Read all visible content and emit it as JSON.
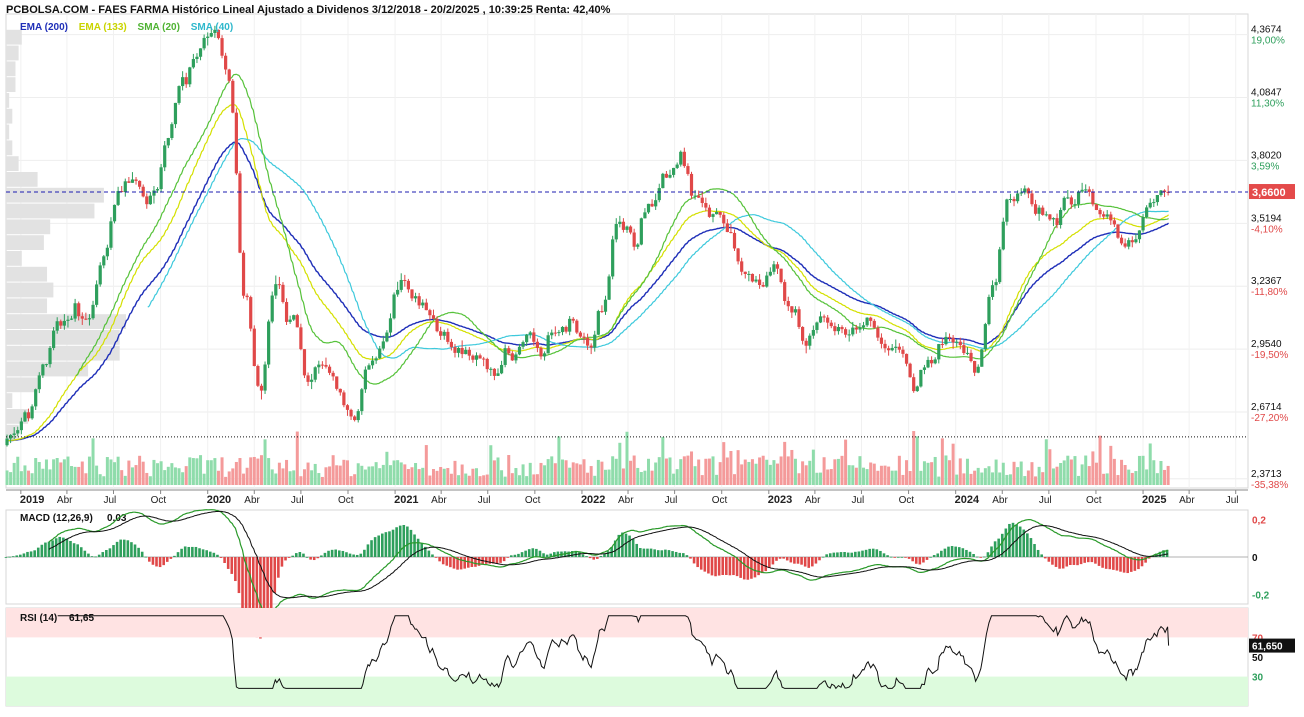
{
  "header": {
    "title": "PCBOLSA.COM - FAES FARMA Histórico Lineal Ajustado a Dividenos 3/12/2018 - 20/2/2025 , 10:39:25 Renta: 42,40%"
  },
  "legend": [
    {
      "label": "EMA (200)",
      "color": "#1f2fb8"
    },
    {
      "label": "EMA (133)",
      "color": "#d4e000"
    },
    {
      "label": "SMA (20)",
      "color": "#56c23a"
    },
    {
      "label": "SMA (40)",
      "color": "#3ec9dc"
    }
  ],
  "colors": {
    "up": "#2e9f5c",
    "down": "#e04848",
    "vol_up": "#8fdcab",
    "vol_down": "#f49a9a",
    "price_line": "#1c1cb0",
    "price_tag": "#e44a4a"
  },
  "chart_data": [
    {
      "type": "candlestick",
      "title": "FAES FARMA",
      "x_axis_labels": [
        "2019",
        "Abr",
        "Jul",
        "Oct",
        "2020",
        "Abr",
        "Jul",
        "Oct",
        "2021",
        "Abr",
        "Jul",
        "Oct",
        "2022",
        "Abr",
        "Jul",
        "Oct",
        "2023",
        "Abr",
        "Jul",
        "Oct",
        "2024",
        "Abr",
        "Jul",
        "Oct",
        "2025",
        "Abr",
        "Jul"
      ],
      "y_ticks": [
        {
          "value": 4.3674,
          "label": "4,3674",
          "pct": "19,00%"
        },
        {
          "value": 4.0847,
          "label": "4,0847",
          "pct": "11,30%"
        },
        {
          "value": 3.802,
          "label": "3,8020",
          "pct": "3,59%"
        },
        {
          "value": 3.5194,
          "label": "3,5194",
          "pct": "-4,10%"
        },
        {
          "value": 3.2367,
          "label": "3,2367",
          "pct": "-11,80%"
        },
        {
          "value": 2.954,
          "label": "2,9540",
          "pct": "-19,50%"
        },
        {
          "value": 2.6714,
          "label": "2,6714",
          "pct": "-27,20%"
        },
        {
          "value": 2.3713,
          "label": "2,3713",
          "pct": "-35,38%"
        }
      ],
      "ylim": [
        2.33,
        4.46
      ],
      "last_price": {
        "value": 3.66,
        "label": "3,6600"
      },
      "reference_lines": [
        {
          "value": 3.66,
          "style": "dashed"
        },
        {
          "value": 2.56,
          "style": "dotted"
        }
      ],
      "close_series_monthly": {
        "x": [
          "2018-12",
          "2019-01",
          "2019-02",
          "2019-03",
          "2019-04",
          "2019-05",
          "2019-06",
          "2019-07",
          "2019-08",
          "2019-09",
          "2019-10",
          "2019-11",
          "2019-12",
          "2020-01",
          "2020-02",
          "2020-03",
          "2020-04",
          "2020-05",
          "2020-06",
          "2020-07",
          "2020-08",
          "2020-09",
          "2020-10",
          "2020-11",
          "2020-12",
          "2021-01",
          "2021-02",
          "2021-03",
          "2021-04",
          "2021-05",
          "2021-06",
          "2021-07",
          "2021-08",
          "2021-09",
          "2021-10",
          "2021-11",
          "2021-12",
          "2022-01",
          "2022-02",
          "2022-03",
          "2022-04",
          "2022-05",
          "2022-06",
          "2022-07",
          "2022-08",
          "2022-09",
          "2022-10",
          "2022-11",
          "2022-12",
          "2023-01",
          "2023-02",
          "2023-03",
          "2023-04",
          "2023-05",
          "2023-06",
          "2023-07",
          "2023-08",
          "2023-09",
          "2023-10",
          "2023-11",
          "2023-12",
          "2024-01",
          "2024-02",
          "2024-03",
          "2024-04",
          "2024-05",
          "2024-06",
          "2024-07",
          "2024-08",
          "2024-09",
          "2024-10",
          "2024-11",
          "2024-12",
          "2025-01",
          "2025-02"
        ],
        "close": [
          2.56,
          2.62,
          2.88,
          3.05,
          3.12,
          3.1,
          3.38,
          3.65,
          3.7,
          3.6,
          3.9,
          4.2,
          4.25,
          4.35,
          4.15,
          3.2,
          2.75,
          3.25,
          3.1,
          2.85,
          2.9,
          2.72,
          2.62,
          2.9,
          3.05,
          3.25,
          3.15,
          3.1,
          2.98,
          2.95,
          2.9,
          2.85,
          2.95,
          3.0,
          2.9,
          3.05,
          3.1,
          3.0,
          3.15,
          3.55,
          3.45,
          3.6,
          3.75,
          3.8,
          3.65,
          3.55,
          3.48,
          3.3,
          3.25,
          3.28,
          3.15,
          2.95,
          3.1,
          3.05,
          3.02,
          3.05,
          2.98,
          2.95,
          2.75,
          2.92,
          3.0,
          2.97,
          2.88,
          3.2,
          3.6,
          3.7,
          3.6,
          3.55,
          3.62,
          3.7,
          3.55,
          3.45,
          3.45,
          3.58,
          3.66
        ]
      }
    },
    {
      "type": "bar",
      "title": "MACD (12,26,9)",
      "value_label": "0,03",
      "y_ticks": [
        "0,2",
        "0",
        "-0,2"
      ],
      "ylim": [
        -0.25,
        0.25
      ]
    },
    {
      "type": "line",
      "title": "RSI (14)",
      "value_label": "61,65",
      "last_value": {
        "value": 61.65,
        "label": "61,650"
      },
      "y_ticks": [
        "70",
        "50",
        "30"
      ],
      "zones": [
        {
          "range": [
            70,
            100
          ],
          "color": "#ffe3e3"
        },
        {
          "range": [
            0,
            30
          ],
          "color": "#ddfbdd"
        }
      ]
    }
  ]
}
